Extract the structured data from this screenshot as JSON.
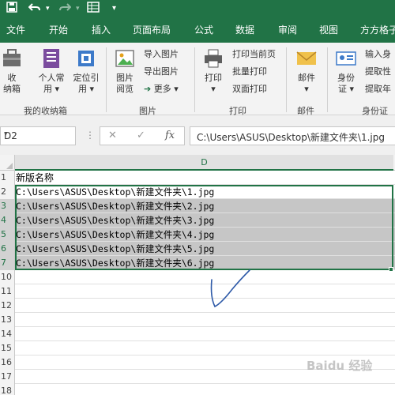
{
  "quick_access": {
    "save_icon": "save-icon",
    "undo_icon": "undo-icon",
    "redo_icon": "redo-icon",
    "form_icon": "form-icon",
    "customize_glyph": "▾"
  },
  "tabs": [
    "文件",
    "开始",
    "插入",
    "页面布局",
    "公式",
    "数据",
    "审阅",
    "视图",
    "方方格子"
  ],
  "ribbon": {
    "collect_label_1": "收",
    "collect_label_2": "纳箱",
    "personal_label_1": "个人常",
    "personal_label_2": "用 ▾",
    "locate_label_1": "定位引",
    "locate_label_2": "用 ▾",
    "group_my_box": "我的收纳箱",
    "pic_view_label_1": "图片",
    "pic_view_label_2": "阅览",
    "import_pic": "导入图片",
    "export_pic": "导出图片",
    "more_label": "更多 ▾",
    "group_pic": "图片",
    "print_label": "打印",
    "print_dd": "▾",
    "print_current": "打印当前页",
    "batch_print": "批量打印",
    "duplex_print": "双面打印",
    "group_print": "打印",
    "mail_label": "邮件",
    "mail_dd": "▾",
    "group_mail": "邮件",
    "id_label_1": "身份",
    "id_label_2": "证 ▾",
    "input_id": "输入身",
    "extract_1": "提取性",
    "extract_2": "提取年",
    "group_id": "身份证"
  },
  "formula_bar": {
    "name_box": "D2",
    "name_box_dd": "▾",
    "more_glyph": "⋮",
    "cancel_glyph": "✕",
    "enter_glyph": "✓",
    "fx_glyph": "fx",
    "formula": "C:\\Users\\ASUS\\Desktop\\新建文件夹\\1.jpg"
  },
  "grid": {
    "column_header": "D",
    "rows": [
      {
        "num": "1",
        "value": "新版名称",
        "selected": false
      },
      {
        "num": "2",
        "value": "C:\\Users\\ASUS\\Desktop\\新建文件夹\\1.jpg",
        "selected": false
      },
      {
        "num": "3",
        "value": "C:\\Users\\ASUS\\Desktop\\新建文件夹\\2.jpg",
        "selected": true
      },
      {
        "num": "4",
        "value": "C:\\Users\\ASUS\\Desktop\\新建文件夹\\3.jpg",
        "selected": true
      },
      {
        "num": "5",
        "value": "C:\\Users\\ASUS\\Desktop\\新建文件夹\\4.jpg",
        "selected": true
      },
      {
        "num": "6",
        "value": "C:\\Users\\ASUS\\Desktop\\新建文件夹\\5.jpg",
        "selected": true
      },
      {
        "num": "7",
        "value": "C:\\Users\\ASUS\\Desktop\\新建文件夹\\6.jpg",
        "selected": true
      },
      {
        "num": "10",
        "value": "",
        "selected": false
      },
      {
        "num": "11",
        "value": "",
        "selected": false
      },
      {
        "num": "12",
        "value": "",
        "selected": false
      },
      {
        "num": "13",
        "value": "",
        "selected": false
      },
      {
        "num": "14",
        "value": "",
        "selected": false
      },
      {
        "num": "15",
        "value": "",
        "selected": false
      },
      {
        "num": "16",
        "value": "",
        "selected": false
      },
      {
        "num": "17",
        "value": "",
        "selected": false
      },
      {
        "num": "18",
        "value": "",
        "selected": false
      }
    ]
  },
  "watermark_text": "Baidu 经验",
  "colors": {
    "excel_green": "#217346",
    "selection_fill": "#c6c6c6",
    "annotation_ink": "#2e5aa8"
  }
}
